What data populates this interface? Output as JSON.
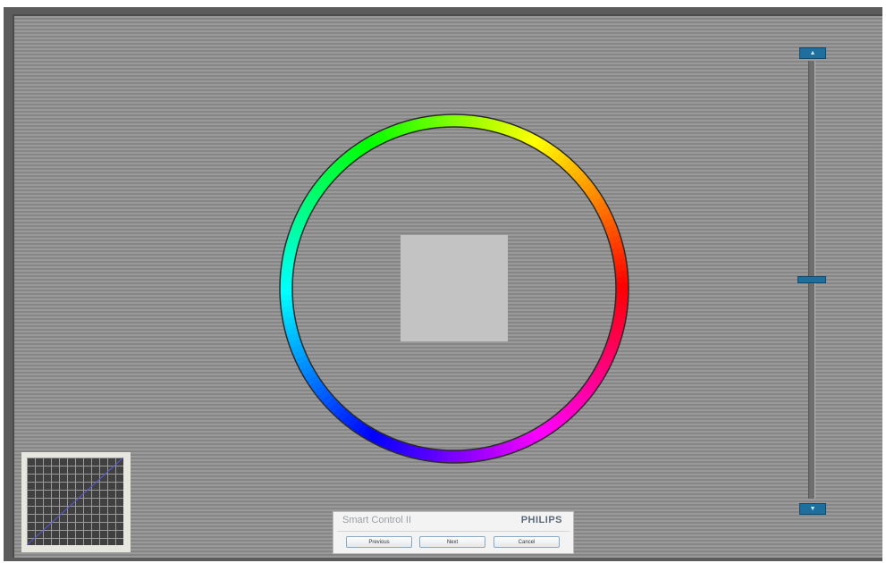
{
  "app": {
    "dialog_title": "Smart Control II",
    "brand": "PHILIPS"
  },
  "buttons": {
    "previous": "Previous",
    "next": "Next",
    "cancel": "Cancel"
  },
  "slider": {
    "up_icon": "up-arrow-icon",
    "down_icon": "down-arrow-icon",
    "up_glyph": "▲",
    "down_glyph": "▼",
    "level": 0.5
  },
  "colors": {
    "accent": "#1e6f9e",
    "background": "#9a9a9a",
    "center_patch": "#c3c3c3"
  }
}
